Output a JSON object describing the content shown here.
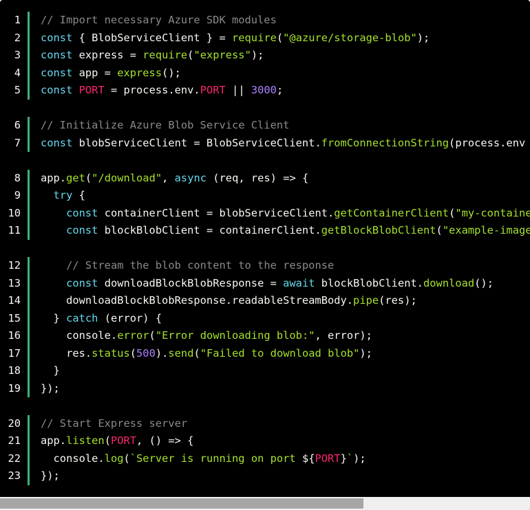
{
  "colors": {
    "background": "#000000",
    "keyword": "#66d9ef",
    "function": "#a6e22e",
    "string": "#a6e22e",
    "comment": "#8a8a8a",
    "constant": "#f92672",
    "number": "#ae81ff",
    "text": "#f8f8f2",
    "gutter_bar": "#3fb07a"
  },
  "code": {
    "language": "javascript",
    "lines": [
      {
        "n": "1",
        "group_gap": false,
        "tokens": [
          [
            "com",
            "// Import necessary Azure SDK modules"
          ]
        ]
      },
      {
        "n": "2",
        "group_gap": false,
        "tokens": [
          [
            "kw",
            "const"
          ],
          [
            "plain",
            " { BlobServiceClient } = "
          ],
          [
            "fn",
            "require"
          ],
          [
            "plain",
            "("
          ],
          [
            "str",
            "\"@azure/storage-blob\""
          ],
          [
            "plain",
            ");"
          ]
        ]
      },
      {
        "n": "3",
        "group_gap": false,
        "tokens": [
          [
            "kw",
            "const"
          ],
          [
            "plain",
            " express = "
          ],
          [
            "fn",
            "require"
          ],
          [
            "plain",
            "("
          ],
          [
            "str",
            "\"express\""
          ],
          [
            "plain",
            ");"
          ]
        ]
      },
      {
        "n": "4",
        "group_gap": false,
        "tokens": [
          [
            "kw",
            "const"
          ],
          [
            "plain",
            " app = "
          ],
          [
            "fn",
            "express"
          ],
          [
            "plain",
            "();"
          ]
        ]
      },
      {
        "n": "5",
        "group_gap": false,
        "tokens": [
          [
            "kw",
            "const"
          ],
          [
            "plain",
            " "
          ],
          [
            "const",
            "PORT"
          ],
          [
            "plain",
            " = process.env."
          ],
          [
            "const",
            "PORT"
          ],
          [
            "plain",
            " || "
          ],
          [
            "num",
            "3000"
          ],
          [
            "plain",
            ";"
          ]
        ]
      },
      {
        "n": "6",
        "group_gap": true,
        "tokens": [
          [
            "com",
            "// Initialize Azure Blob Service Client"
          ]
        ]
      },
      {
        "n": "7",
        "group_gap": false,
        "tokens": [
          [
            "kw",
            "const"
          ],
          [
            "plain",
            " blobServiceClient = BlobServiceClient."
          ],
          [
            "fn",
            "fromConnectionString"
          ],
          [
            "plain",
            "(process.env"
          ]
        ]
      },
      {
        "n": "8",
        "group_gap": true,
        "tokens": [
          [
            "plain",
            "app."
          ],
          [
            "fn",
            "get"
          ],
          [
            "plain",
            "("
          ],
          [
            "str",
            "\"/download\""
          ],
          [
            "plain",
            ", "
          ],
          [
            "kw",
            "async"
          ],
          [
            "plain",
            " (req, res) => {"
          ]
        ]
      },
      {
        "n": "9",
        "group_gap": false,
        "tokens": [
          [
            "plain",
            "  "
          ],
          [
            "kw",
            "try"
          ],
          [
            "plain",
            " {"
          ]
        ]
      },
      {
        "n": "10",
        "group_gap": false,
        "tokens": [
          [
            "plain",
            "    "
          ],
          [
            "kw",
            "const"
          ],
          [
            "plain",
            " containerClient = blobServiceClient."
          ],
          [
            "fn",
            "getContainerClient"
          ],
          [
            "plain",
            "("
          ],
          [
            "str",
            "\"my-containe"
          ]
        ]
      },
      {
        "n": "11",
        "group_gap": false,
        "tokens": [
          [
            "plain",
            "    "
          ],
          [
            "kw",
            "const"
          ],
          [
            "plain",
            " blockBlobClient = containerClient."
          ],
          [
            "fn",
            "getBlockBlobClient"
          ],
          [
            "plain",
            "("
          ],
          [
            "str",
            "\"example-image"
          ]
        ]
      },
      {
        "n": "12",
        "group_gap": true,
        "tokens": [
          [
            "plain",
            "    "
          ],
          [
            "com",
            "// Stream the blob content to the response"
          ]
        ]
      },
      {
        "n": "13",
        "group_gap": false,
        "tokens": [
          [
            "plain",
            "    "
          ],
          [
            "kw",
            "const"
          ],
          [
            "plain",
            " downloadBlockBlobResponse = "
          ],
          [
            "kw",
            "await"
          ],
          [
            "plain",
            " blockBlobClient."
          ],
          [
            "fn",
            "download"
          ],
          [
            "plain",
            "();"
          ]
        ]
      },
      {
        "n": "14",
        "group_gap": false,
        "tokens": [
          [
            "plain",
            "    downloadBlockBlobResponse.readableStreamBody."
          ],
          [
            "fn",
            "pipe"
          ],
          [
            "plain",
            "(res);"
          ]
        ]
      },
      {
        "n": "15",
        "group_gap": false,
        "tokens": [
          [
            "plain",
            "  } "
          ],
          [
            "kw",
            "catch"
          ],
          [
            "plain",
            " (error) {"
          ]
        ]
      },
      {
        "n": "16",
        "group_gap": false,
        "tokens": [
          [
            "plain",
            "    console."
          ],
          [
            "fn",
            "error"
          ],
          [
            "plain",
            "("
          ],
          [
            "str",
            "\"Error downloading blob:\""
          ],
          [
            "plain",
            ", error);"
          ]
        ]
      },
      {
        "n": "17",
        "group_gap": false,
        "tokens": [
          [
            "plain",
            "    res."
          ],
          [
            "fn",
            "status"
          ],
          [
            "plain",
            "("
          ],
          [
            "num",
            "500"
          ],
          [
            "plain",
            ")."
          ],
          [
            "fn",
            "send"
          ],
          [
            "plain",
            "("
          ],
          [
            "str",
            "\"Failed to download blob\""
          ],
          [
            "plain",
            ");"
          ]
        ]
      },
      {
        "n": "18",
        "group_gap": false,
        "tokens": [
          [
            "plain",
            "  }"
          ]
        ]
      },
      {
        "n": "19",
        "group_gap": false,
        "tokens": [
          [
            "plain",
            "});"
          ]
        ]
      },
      {
        "n": "20",
        "group_gap": true,
        "tokens": [
          [
            "com",
            "// Start Express server"
          ]
        ]
      },
      {
        "n": "21",
        "group_gap": false,
        "tokens": [
          [
            "plain",
            "app."
          ],
          [
            "fn",
            "listen"
          ],
          [
            "plain",
            "("
          ],
          [
            "const",
            "PORT"
          ],
          [
            "plain",
            ", () => {"
          ]
        ]
      },
      {
        "n": "22",
        "group_gap": false,
        "tokens": [
          [
            "plain",
            "  console."
          ],
          [
            "fn",
            "log"
          ],
          [
            "plain",
            "("
          ],
          [
            "str",
            "`Server is running on port "
          ],
          [
            "plain",
            "${"
          ],
          [
            "const",
            "PORT"
          ],
          [
            "plain",
            "}"
          ],
          [
            "str",
            "`"
          ],
          [
            "plain",
            ");"
          ]
        ]
      },
      {
        "n": "23",
        "group_gap": false,
        "tokens": [
          [
            "plain",
            "});"
          ]
        ]
      }
    ]
  },
  "scroll": {
    "horizontal_position": 0,
    "visible_fraction": 0.686
  }
}
